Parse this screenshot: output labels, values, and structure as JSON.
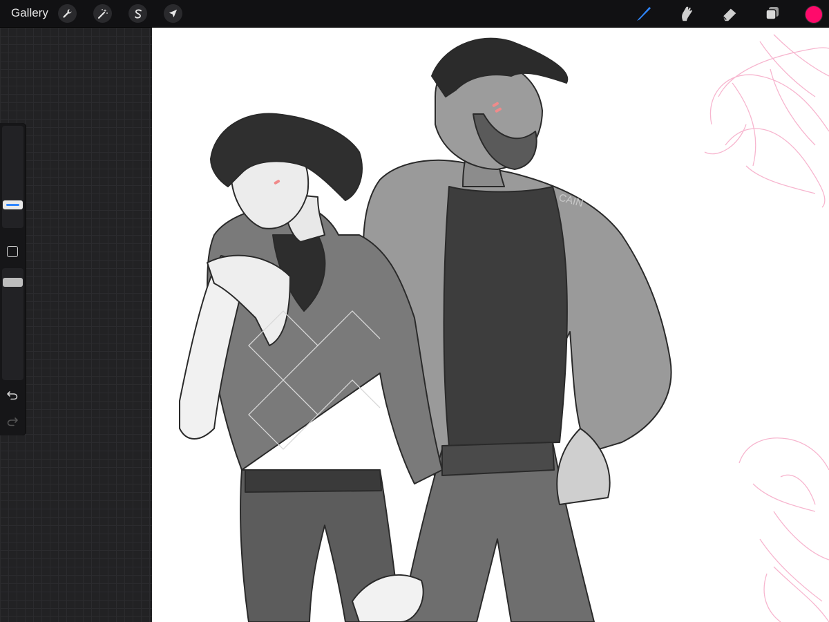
{
  "toolbar": {
    "gallery_label": "Gallery",
    "left_tools": [
      {
        "name": "actions",
        "icon": "wrench-icon"
      },
      {
        "name": "adjustments",
        "icon": "magic-wand-icon"
      },
      {
        "name": "selection",
        "icon": "selection-s-icon"
      },
      {
        "name": "transform",
        "icon": "arrow-cursor-icon"
      }
    ],
    "right_tools": [
      {
        "name": "brush",
        "icon": "brush-icon",
        "active": true
      },
      {
        "name": "smudge",
        "icon": "smudge-icon"
      },
      {
        "name": "eraser",
        "icon": "eraser-icon"
      },
      {
        "name": "layers",
        "icon": "layers-icon"
      }
    ],
    "current_color": "#ff0a6b",
    "active_tool_color": "#2f86ff"
  },
  "sidebar": {
    "brush_size_icon": "brush-size-slider",
    "modify_icon": "square-modify-icon",
    "opacity_icon": "opacity-slider",
    "undo_icon": "undo-icon",
    "redo_icon": "redo-icon"
  },
  "canvas": {
    "signature_text": "CAIN",
    "sketch_color": "#f7b6cf"
  }
}
